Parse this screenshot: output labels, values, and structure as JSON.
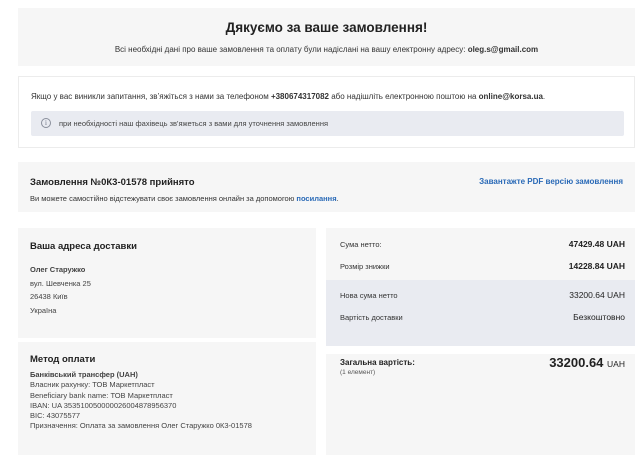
{
  "thanks": {
    "title": "Дякуємо за ваше замовлення!",
    "subtitle_prefix": "Всі необхідні дані про ваше замовлення та оплату були надіслані на вашу електронну адресу: ",
    "email": "oleg.s@gmail.com"
  },
  "contact": {
    "text_prefix": "Якщо у вас виникли запитання, зв’яжіться з нами за телефоном ",
    "phone": "+380674317082",
    "text_middle": " або надішліть електронною поштою на ",
    "email": "online@korsa.ua",
    "text_suffix": ".",
    "info_icon": "info-icon",
    "note": "при необхідності наш фахівець зв'яжеться з вами для уточнення замовлення"
  },
  "order": {
    "title": "Замовлення №0К3-01578 прийнято",
    "tracking_prefix": "Ви можете самостійно відстежувати своє замовлення онлайн за допомогою ",
    "tracking_link": "посилання",
    "tracking_suffix": ".",
    "pdf_link": "Завантажте PDF версію замовлення"
  },
  "address": {
    "heading": "Ваша адреса доставки",
    "name": "Олег Старужко",
    "street": "вул. Шевченка 25",
    "city": "26438 Київ",
    "country": "Україна"
  },
  "payment": {
    "heading": "Метод оплати",
    "method": "Банківський трансфер (UAH)",
    "owner": "Власник рахунку: ТОВ Маркетпласт",
    "beneficiary": "Beneficiary bank name: ТОВ Маркетпласт",
    "iban": "IBAN: UA 353510050000026004878956370",
    "bic": "BIC: 43075577",
    "purpose": "Призначення: Оплата за замовлення Олег Старужко 0К3-01578"
  },
  "totals": {
    "net_label": "Сума нетто:",
    "net_value": "47429.48 UAH",
    "discount_label": "Розмір знижки",
    "discount_value": "14228.84 UAH",
    "new_net_label": "Нова сума нетто",
    "new_net_value": "33200.64 UAH",
    "delivery_label": "Вартість доставки",
    "delivery_value": "Безкоштовно",
    "grand_label": "Загальна вартість:",
    "grand_count": "(1 елемент)",
    "grand_amount": "33200.64",
    "grand_currency": "UAH"
  }
}
